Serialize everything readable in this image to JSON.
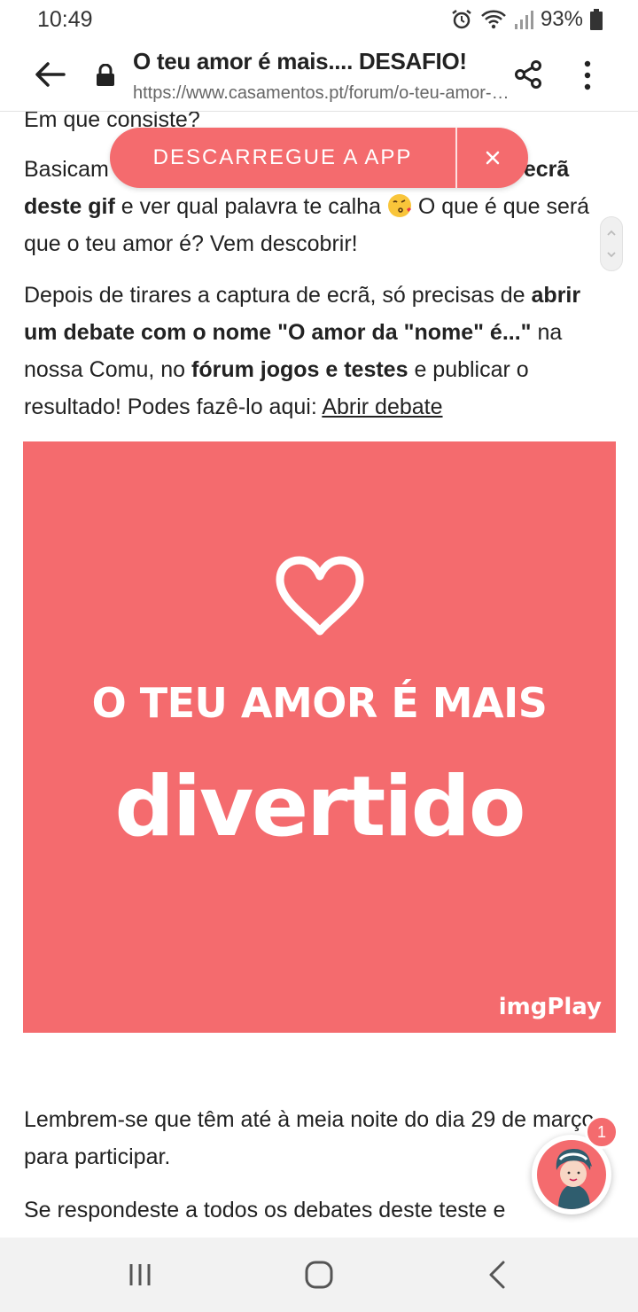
{
  "status_bar": {
    "time": "10:49",
    "battery": "93%"
  },
  "browser": {
    "title": "O teu amor é mais.... DESAFIO!",
    "url": "https://www.casamentos.pt/forum/o-teu-amor-e-mais-desafio"
  },
  "app_banner": {
    "label": "DESCARREGUE A APP",
    "close": "×"
  },
  "article": {
    "heading_partial": "Em que consiste?",
    "p1_start": "Basicam",
    "p1_bold_end": "ecrã",
    "p1_bold_2": "deste gif",
    "p1_text_2": " e ver qual palavra te calha ",
    "p1_text_3": " O que é que será que o teu amor é? Vem descobrir!",
    "p2_text_1": "Depois de tirares a captura de ecrã, só precisas de ",
    "p2_bold_1": "abrir um debate com o nome \"O amor da \"nome\" é...\"",
    "p2_text_2": " na nossa Comu, no ",
    "p2_bold_2": "fórum jogos e testes",
    "p2_text_3": " e publicar o resultado! Podes fazê-lo aqui: ",
    "p2_link": "Abrir debate",
    "p4": "Lembrem-se que têm até à meia noite do dia 29 de março para participar.",
    "p5": "Se respondeste a todos os debates deste teste e"
  },
  "gif": {
    "line1": "O TEU AMOR É MAIS",
    "line2": "divertido",
    "brand": "imgPlay",
    "background": "#f46b6e"
  },
  "chat": {
    "badge": "1"
  },
  "colors": {
    "accent": "#f46b6e"
  }
}
